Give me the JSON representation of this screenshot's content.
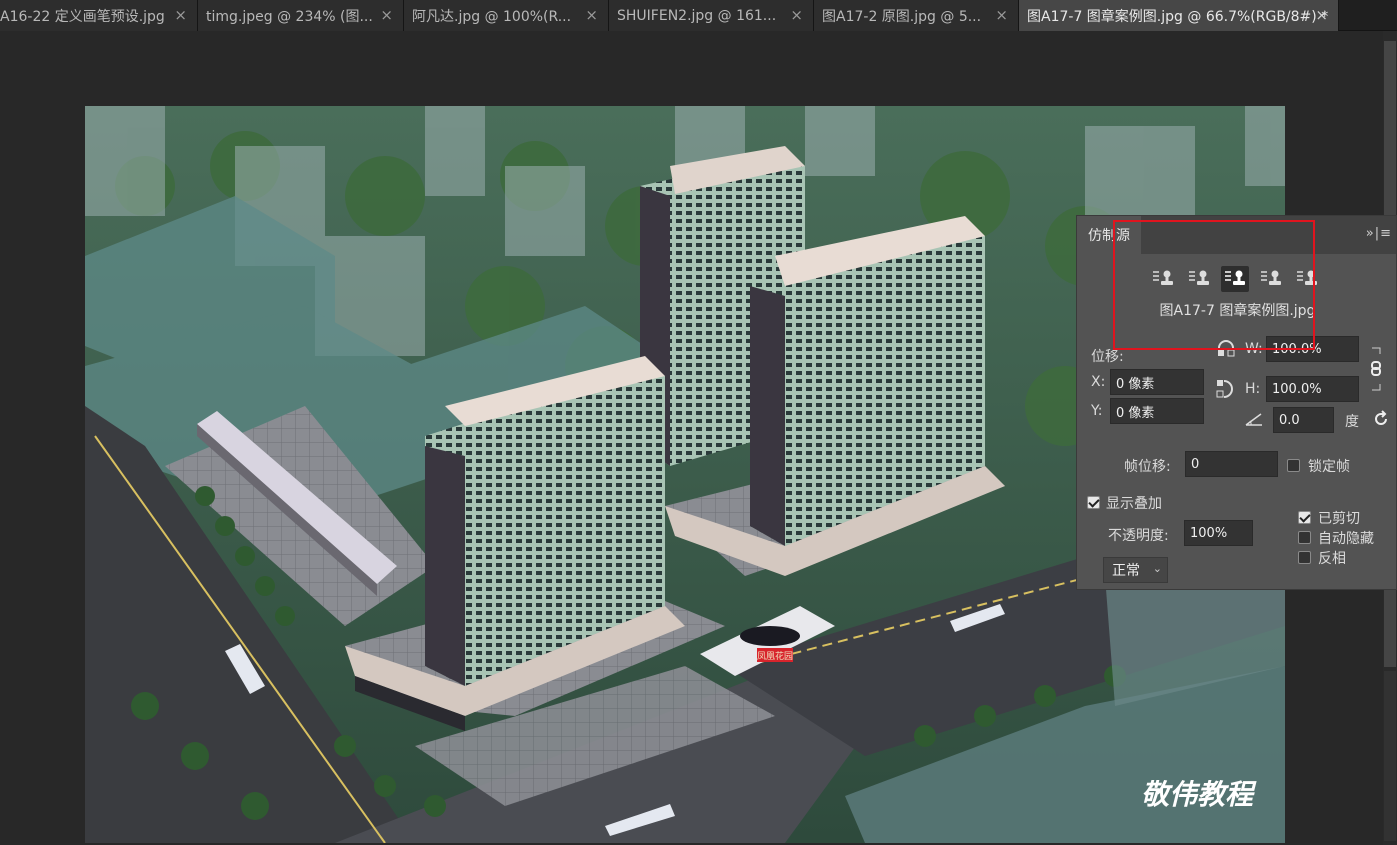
{
  "tabs": [
    {
      "label": "A16-22 定义画笔预设.jpg",
      "active": false,
      "width": 198
    },
    {
      "label": "timg.jpeg @ 234% (图...",
      "active": false,
      "width": 206
    },
    {
      "label": "阿凡达.jpg @ 100%(R...",
      "active": false,
      "width": 205
    },
    {
      "label": "SHUIFEN2.jpg @ 161...",
      "active": false,
      "width": 205
    },
    {
      "label": "图A17-2 原图.jpg @ 5...",
      "active": false,
      "width": 205
    },
    {
      "label": "图A17-7 图章案例图.jpg @ 66.7%(RGB/8#) *",
      "active": true,
      "width": 320
    }
  ],
  "watermark": "敬伟教程",
  "bus_sign": "凤凰花园",
  "panel": {
    "title": "仿制源",
    "menu_icon": "»|≡",
    "source_name": "图A17-7 图章案例图.jpg",
    "offset_label": "位移:",
    "x_label": "X:",
    "x_value": "0 像素",
    "y_label": "Y:",
    "y_value": "0 像素",
    "w_label": "W:",
    "w_value": "100.0%",
    "h_label": "H:",
    "h_value": "100.0%",
    "angle_value": "0.0",
    "angle_unit": "度",
    "frame_offset_label": "帧位移:",
    "frame_offset_value": "0",
    "lock_frame_label": "锁定帧",
    "show_overlay_label": "显示叠加",
    "opacity_label": "不透明度:",
    "opacity_value": "100%",
    "blend_mode": "正常",
    "clipped_label": "已剪切",
    "auto_hide_label": "自动隐藏",
    "invert_label": "反相",
    "show_overlay_checked": true,
    "lock_frame_checked": false,
    "clipped_checked": true,
    "auto_hide_checked": false,
    "invert_checked": false
  }
}
